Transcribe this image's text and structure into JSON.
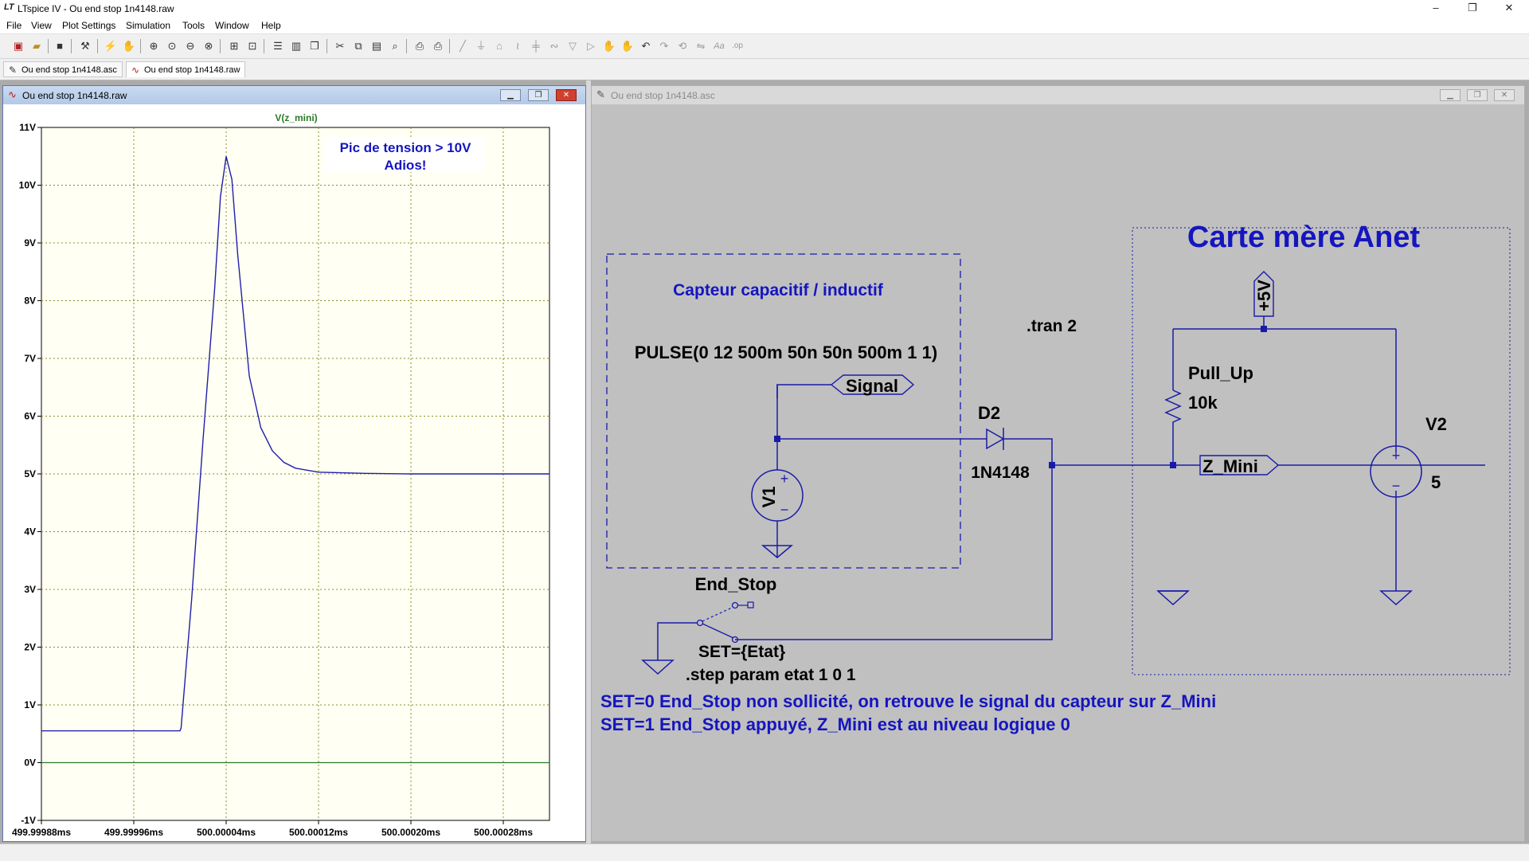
{
  "app": {
    "title": "LTspice IV - Ou end stop 1n4148.raw",
    "icon_text": "LT"
  },
  "window_controls": {
    "minimize": "–",
    "restore": "❐",
    "close": "✕"
  },
  "menu": [
    "File",
    "View",
    "Plot Settings",
    "Simulation",
    "Tools",
    "Window",
    "Help"
  ],
  "tabs": [
    {
      "label": "Ou end stop 1n4148.asc",
      "icon": "schematic-icon"
    },
    {
      "label": "Ou end stop 1n4148.raw",
      "icon": "waveform-icon"
    }
  ],
  "waveform_window": {
    "title": "Ou end stop 1n4148.raw",
    "trace_label": "V(z_mini)",
    "annotation_line1": "Pic de tension > 10V",
    "annotation_line2": "Adios!"
  },
  "schematic_window": {
    "title": "Ou end stop 1n4148.asc",
    "board_label": "Carte mère Anet",
    "sensor_label": "Capteur capacitif / inductif",
    "pulse_spec": "PULSE(0 12 500m 50n 50n 500m 1 1)",
    "tran_directive": ".tran 2",
    "signal_net": "Signal",
    "diode_name": "D2",
    "diode_model": "1N4148",
    "source1_name": "V1",
    "resistor_name": "Pull_Up",
    "resistor_value": "10k",
    "supply_label": "+5V",
    "source2_name": "V2",
    "source2_value": "5",
    "output_net": "Z_Mini",
    "switch_name": "End_Stop",
    "switch_param": "SET={Etat}",
    "step_directive": ".step param etat 1 0 1",
    "note1": "SET=0  End_Stop non sollicité, on retrouve le signal du capteur sur Z_Mini",
    "note2": "SET=1  End_Stop appuyé, Z_Mini est au niveau logique 0"
  },
  "colors": {
    "trace": "#1f1faa",
    "grid": "#8c8c28",
    "plot_bg": "#fffff4",
    "wire": "#1a1aa8",
    "schematic_bg": "#c0c0c0",
    "label_blue": "#1515c0",
    "zero_line": "#2a7a2a"
  },
  "chart_data": {
    "type": "line",
    "title": "V(z_mini)",
    "xlabel": "",
    "ylabel": "",
    "x_tick_labels": [
      "499.99988ms",
      "499.99996ms",
      "500.00004ms",
      "500.00012ms",
      "500.00020ms",
      "500.00028ms"
    ],
    "y_tick_labels": [
      "11V",
      "10V",
      "9V",
      "8V",
      "7V",
      "6V",
      "5V",
      "4V",
      "3V",
      "2V",
      "1V",
      "0V",
      "-1V"
    ],
    "xlim_ms": [
      499.99988,
      500.00032
    ],
    "ylim": [
      -1,
      11
    ],
    "grid": true,
    "series": [
      {
        "name": "V(z_mini)",
        "x_ms": [
          499.99988,
          499.99992,
          499.99996,
          500.0,
          500.000001,
          500.00001,
          500.00002,
          500.00003,
          500.000035,
          500.00004,
          500.000045,
          500.00005,
          500.00006,
          500.00007,
          500.00008,
          500.00009,
          500.0001,
          500.00012,
          500.00016,
          500.0002,
          500.00024,
          500.00028,
          500.00032
        ],
        "y_v": [
          0.55,
          0.55,
          0.55,
          0.55,
          0.6,
          2.8,
          5.6,
          8.2,
          9.8,
          10.5,
          10.1,
          8.8,
          6.7,
          5.8,
          5.4,
          5.2,
          5.1,
          5.03,
          5.01,
          5.0,
          5.0,
          5.0,
          5.0
        ]
      }
    ]
  }
}
